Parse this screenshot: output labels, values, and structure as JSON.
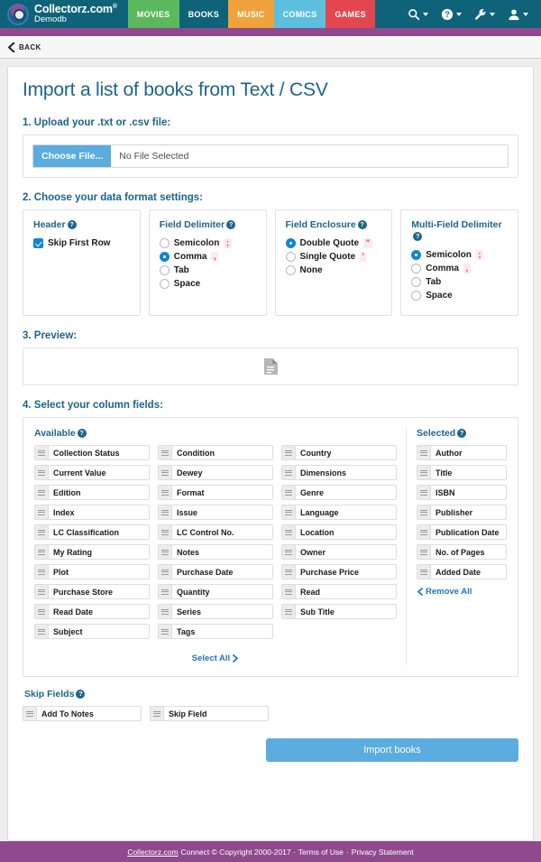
{
  "header": {
    "brand_name": "Collectorz.com",
    "brand_reg": "®",
    "brand_sub": "Demodb",
    "tabs": [
      {
        "label": "MOVIES",
        "color": "#5cb85c"
      },
      {
        "label": "BOOKS",
        "color": "transparent"
      },
      {
        "label": "MUSIC",
        "color": "#f0a33c"
      },
      {
        "label": "COMICS",
        "color": "#5bc0de"
      },
      {
        "label": "GAMES",
        "color": "#e3464f"
      }
    ],
    "icons": [
      "search-icon",
      "help-icon",
      "wrench-icon",
      "user-icon"
    ],
    "bar_color": "#0f6378",
    "strip_color": "#8e4a8c"
  },
  "backbar": {
    "label": "BACK"
  },
  "page": {
    "title": "Import a list of books from Text / CSV",
    "title_color": "#1d6488"
  },
  "step1": {
    "label": "1. Upload your .txt or .csv file:",
    "choose_button": "Choose File...",
    "file_status": "No File Selected"
  },
  "step2": {
    "label": "2. Choose your data format settings:",
    "panels": [
      {
        "title": "Header",
        "help": "?",
        "checkbox": {
          "label": "Skip First Row",
          "checked": true
        }
      },
      {
        "title": "Field Delimiter",
        "help": "?",
        "options": [
          {
            "label": "Semicolon",
            "symbol": ";",
            "selected": false
          },
          {
            "label": "Comma",
            "symbol": ",",
            "selected": true
          },
          {
            "label": "Tab",
            "symbol": "",
            "selected": false
          },
          {
            "label": "Space",
            "symbol": "",
            "selected": false
          }
        ]
      },
      {
        "title": "Field Enclosure",
        "help": "?",
        "options": [
          {
            "label": "Double Quote",
            "symbol": "\"",
            "selected": true
          },
          {
            "label": "Single Quote",
            "symbol": "'",
            "selected": false
          },
          {
            "label": "None",
            "symbol": "",
            "selected": false
          }
        ]
      },
      {
        "title": "Multi-Field Delimiter",
        "help": "?",
        "options": [
          {
            "label": "Semicolon",
            "symbol": ";",
            "selected": true
          },
          {
            "label": "Comma",
            "symbol": ",",
            "selected": false
          },
          {
            "label": "Tab",
            "symbol": "",
            "selected": false
          },
          {
            "label": "Space",
            "symbol": "",
            "selected": false
          }
        ]
      }
    ]
  },
  "step3": {
    "label": "3. Preview:",
    "icon": "document-icon",
    "content": ""
  },
  "step4": {
    "label": "4. Select your column fields:",
    "available_title": "Available",
    "available_columns": [
      [
        "Collection Status",
        "Current Value",
        "Edition",
        "Index",
        "LC Classification",
        "My Rating",
        "Plot",
        "Purchase Store",
        "Read Date",
        "Subject"
      ],
      [
        "Condition",
        "Dewey",
        "Format",
        "Issue",
        "LC Control No.",
        "Notes",
        "Purchase Date",
        "Quantity",
        "Series",
        "Tags"
      ],
      [
        "Country",
        "Dimensions",
        "Genre",
        "Language",
        "Location",
        "Owner",
        "Purchase Price",
        "Read",
        "Sub Title"
      ]
    ],
    "select_all": "Select All",
    "selected_title": "Selected",
    "selected_fields": [
      "Author",
      "Title",
      "ISBN",
      "Publisher",
      "Publication Date",
      "No. of Pages",
      "Added Date"
    ],
    "remove_all": "Remove All",
    "skip_title": "Skip Fields",
    "skip_fields": [
      "Add To Notes",
      "Skip Field"
    ]
  },
  "actions": {
    "import_button": "Import books",
    "import_color": "#5bacdf"
  },
  "footer": {
    "link": "Collectorz.com",
    "text": " Connect © Copyright 2000-2017 · ",
    "terms": "Terms of Use",
    "sep": " · ",
    "privacy": "Privacy Statement",
    "bg": "#8e4a8c"
  }
}
